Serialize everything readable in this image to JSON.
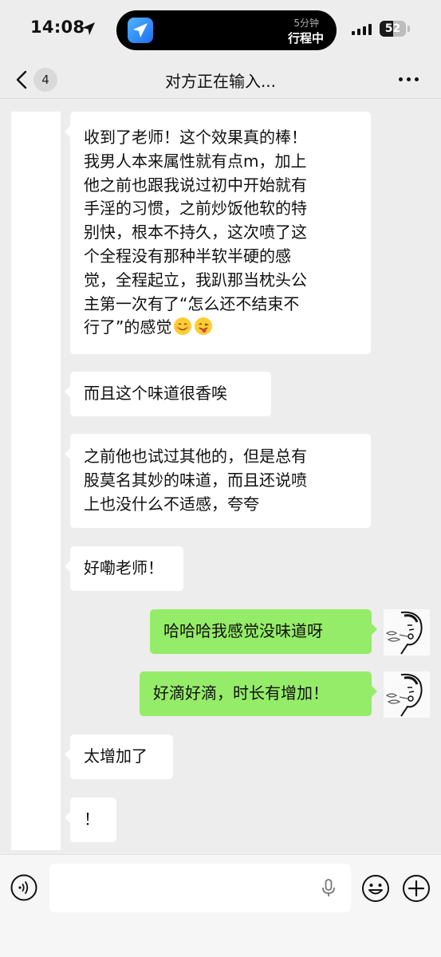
{
  "status_bar": {
    "time": "14:08",
    "island_top": "5分钟",
    "island_bottom": "行程中",
    "battery_percent": 52,
    "battery_label": "52",
    "signal_bars": 4,
    "icons": [
      "location-arrow-icon",
      "travel-app-icon",
      "cellular-signal-icon",
      "battery-icon"
    ]
  },
  "nav": {
    "back_count": "4",
    "title": "对方正在输入...",
    "icons": [
      "back-chevron-icon",
      "more-dots-icon"
    ]
  },
  "messages": [
    {
      "side": "incoming",
      "lines": [
        "收到了老师！这个效果真的棒！",
        "我男人本来属性就有点m，加上",
        "他之前也跟我说过初中开始就有",
        "手淫的习惯，之前炒饭他软的特",
        "别快，根本不持久，这次喷了这",
        "个全程没有那种半软半硬的感",
        "觉，全程起立，我趴那当枕头公",
        "主第一次有了“怎么还不结束不",
        "行了”的感觉"
      ],
      "trailing_emoji": [
        "smiling-face-icon",
        "tongue-face-icon"
      ]
    },
    {
      "side": "incoming",
      "lines": [
        "而且这个味道很香唉"
      ]
    },
    {
      "side": "incoming",
      "lines": [
        "之前他也试过其他的，但是总有",
        "股莫名其妙的味道，而且还说喷",
        "上也没什么不适感，夸夸"
      ]
    },
    {
      "side": "incoming",
      "lines": [
        "好嘞老师！"
      ]
    },
    {
      "side": "outgoing",
      "lines": [
        "哈哈哈我感觉没味道呀"
      ]
    },
    {
      "side": "outgoing",
      "lines": [
        "好滴好滴，时长有增加！"
      ]
    },
    {
      "side": "incoming",
      "lines": [
        "太增加了"
      ]
    },
    {
      "side": "incoming",
      "lines": [
        "！"
      ]
    }
  ],
  "input_bar": {
    "text_value": "",
    "icons": [
      "voice-icon",
      "microphone-icon",
      "emoji-icon",
      "plus-icon"
    ]
  },
  "colors": {
    "background": "#ededed",
    "incoming_bubble": "#ffffff",
    "outgoing_bubble": "#95ec69"
  }
}
